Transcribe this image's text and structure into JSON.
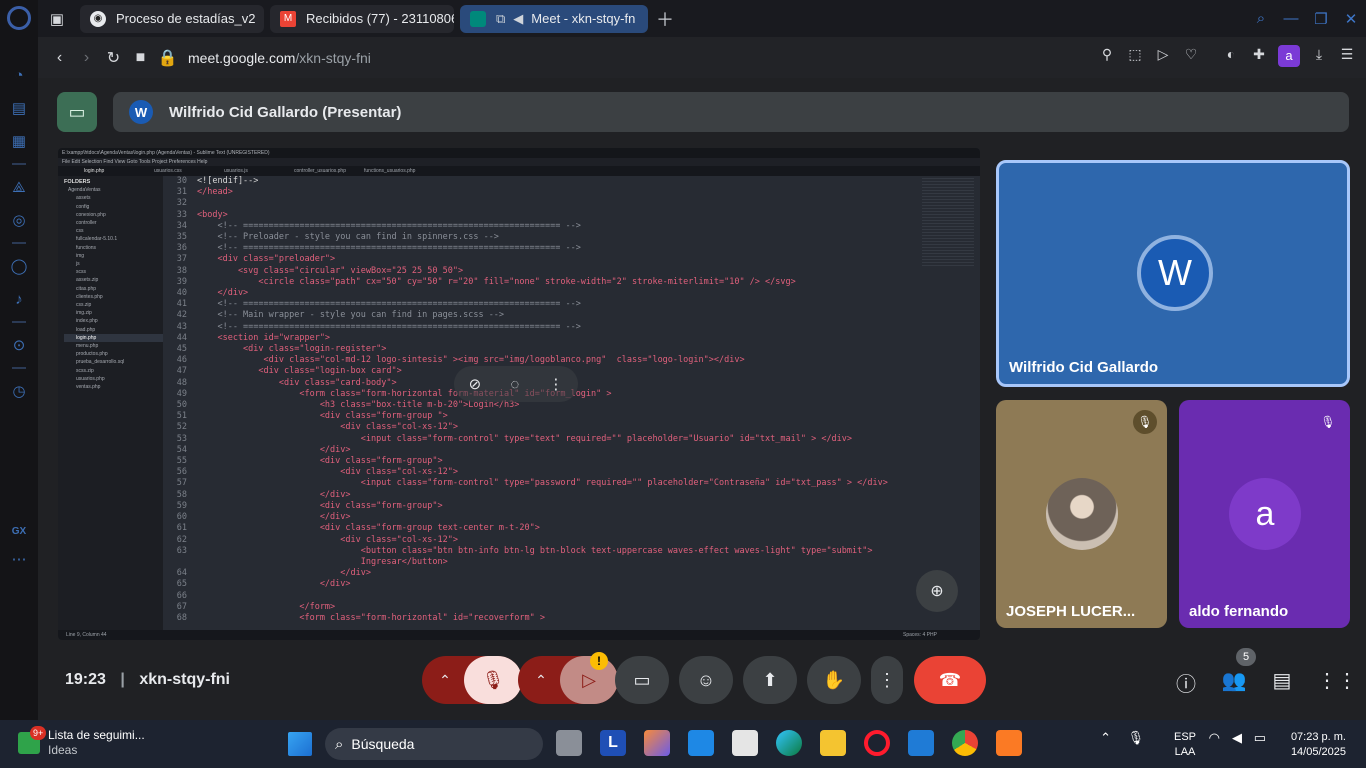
{
  "browser": {
    "tabs": [
      {
        "label": "Proceso de estadías_v2"
      },
      {
        "label": "Recibidos (77) - 23110806"
      },
      {
        "label": "Meet - xkn-stqy-fn"
      }
    ],
    "url_domain": "meet.google.com",
    "url_path": "/xkn-stqy-fni",
    "profile_letter": "a"
  },
  "meet": {
    "presenter_avatar": "W",
    "presenter_label": "Wilfrido Cid Gallardo (Presentar)",
    "time": "19:23",
    "meeting_code": "xkn-stqy-fni",
    "people_count": "5",
    "warning_badge": "!"
  },
  "screen": {
    "window_title": "E:\\xampp\\htdocs\\AgendaVentas\\login.php (AgendaVentas) - Sublime Text (UNREGISTERED)",
    "menu": "File   Edit   Selection   Find   View   Goto   Tools   Project   Preferences   Help",
    "tabs": [
      "login.php",
      "usuarios.css",
      "usuarios.js",
      "controller_usuarios.php",
      "functions_usuarios.php"
    ],
    "folders_header": "FOLDERS",
    "tree": [
      "AgendaVentas",
      "assets",
      "config",
      "conexion.php",
      "controller",
      "css",
      "fullcalendar-5.10.1",
      "functions",
      "img",
      "js",
      "scss",
      "assets.zip",
      "citas.php",
      "clientes.php",
      "css.zip",
      "img.zip",
      "index.php",
      "load.php",
      "login.php",
      "menu.php",
      "productos.php",
      "prueba_desarrollo.sql",
      "scss.zip",
      "usuarios.php",
      "ventas.php"
    ],
    "status_left": "Line 9, Column 44",
    "status_right": "Spaces: 4        PHP"
  },
  "code_lines": [
    {
      "n": "30",
      "t": "<![endif]-->"
    },
    {
      "n": "31",
      "t": "</head>"
    },
    {
      "n": "32",
      "t": ""
    },
    {
      "n": "33",
      "t": "<body>"
    },
    {
      "n": "34",
      "t": "    <!-- ============================================================== -->"
    },
    {
      "n": "35",
      "t": "    <!-- Preloader - style you can find in spinners.css -->"
    },
    {
      "n": "36",
      "t": "    <!-- ============================================================== -->"
    },
    {
      "n": "37",
      "t": "    <div class=\"preloader\">"
    },
    {
      "n": "38",
      "t": "        <svg class=\"circular\" viewBox=\"25 25 50 50\">"
    },
    {
      "n": "39",
      "t": "            <circle class=\"path\" cx=\"50\" cy=\"50\" r=\"20\" fill=\"none\" stroke-width=\"2\" stroke-miterlimit=\"10\" /> </svg>"
    },
    {
      "n": "40",
      "t": "    </div>"
    },
    {
      "n": "41",
      "t": "    <!-- ============================================================== -->"
    },
    {
      "n": "42",
      "t": "    <!-- Main wrapper - style you can find in pages.scss -->"
    },
    {
      "n": "43",
      "t": "    <!-- ============================================================== -->"
    },
    {
      "n": "44",
      "t": "    <section id=\"wrapper\">"
    },
    {
      "n": "45",
      "t": "         <div class=\"login-register\">"
    },
    {
      "n": "46",
      "t": "             <div class=\"col-md-12 logo-sintesis\" ><img src=\"img/logoblanco.png\"  class=\"logo-login\"></div>"
    },
    {
      "n": "47",
      "t": "            <div class=\"login-box card\">"
    },
    {
      "n": "48",
      "t": "                <div class=\"card-body\">"
    },
    {
      "n": "49",
      "t": "                    <form class=\"form-horizontal form-material\" id=\"form_login\" >"
    },
    {
      "n": "50",
      "t": "                        <h3 class=\"box-title m-b-20\">Login</h3>"
    },
    {
      "n": "51",
      "t": "                        <div class=\"form-group \">"
    },
    {
      "n": "52",
      "t": "                            <div class=\"col-xs-12\">"
    },
    {
      "n": "53",
      "t": "                                <input class=\"form-control\" type=\"text\" required=\"\" placeholder=\"Usuario\" id=\"txt_mail\" > </div>"
    },
    {
      "n": "54",
      "t": "                        </div>"
    },
    {
      "n": "55",
      "t": "                        <div class=\"form-group\">"
    },
    {
      "n": "56",
      "t": "                            <div class=\"col-xs-12\">"
    },
    {
      "n": "57",
      "t": "                                <input class=\"form-control\" type=\"password\" required=\"\" placeholder=\"Contraseña\" id=\"txt_pass\" > </div>"
    },
    {
      "n": "58",
      "t": "                        </div>"
    },
    {
      "n": "59",
      "t": "                        <div class=\"form-group\">"
    },
    {
      "n": "60",
      "t": "                        </div>"
    },
    {
      "n": "61",
      "t": "                        <div class=\"form-group text-center m-t-20\">"
    },
    {
      "n": "62",
      "t": "                            <div class=\"col-xs-12\">"
    },
    {
      "n": "63",
      "t": "                                <button class=\"btn btn-info btn-lg btn-block text-uppercase waves-effect waves-light\" type=\"submit\">"
    },
    {
      "n": "",
      "t": "                                Ingresar</button>"
    },
    {
      "n": "64",
      "t": "                            </div>"
    },
    {
      "n": "65",
      "t": "                        </div>"
    },
    {
      "n": "66",
      "t": ""
    },
    {
      "n": "67",
      "t": "                    </form>"
    },
    {
      "n": "68",
      "t": "                    <form class=\"form-horizontal\" id=\"recoverform\" >"
    }
  ],
  "participants": {
    "main": {
      "name": "Wilfrido Cid Gallardo",
      "initial": "W"
    },
    "p2": {
      "name": "JOSEPH LUCER..."
    },
    "p3": {
      "name": "aldo fernando",
      "initial": "a"
    }
  },
  "taskbar": {
    "news_title": "Lista de seguimi...",
    "news_sub": "Ideas",
    "news_badge": "9+",
    "search_placeholder": "Búsqueda",
    "lang_top": "ESP",
    "lang_bottom": "LAA",
    "clock_time": "07:23 p. m.",
    "clock_date": "14/05/2025"
  },
  "sidebar_label": "GX",
  "colors": {
    "accent": "#a8c7fa",
    "end_call": "#ea4335",
    "mic_off_bg": "#f9dedc",
    "tile_main": "#2e67ad",
    "tile_aldo": "#6a2cb0"
  }
}
